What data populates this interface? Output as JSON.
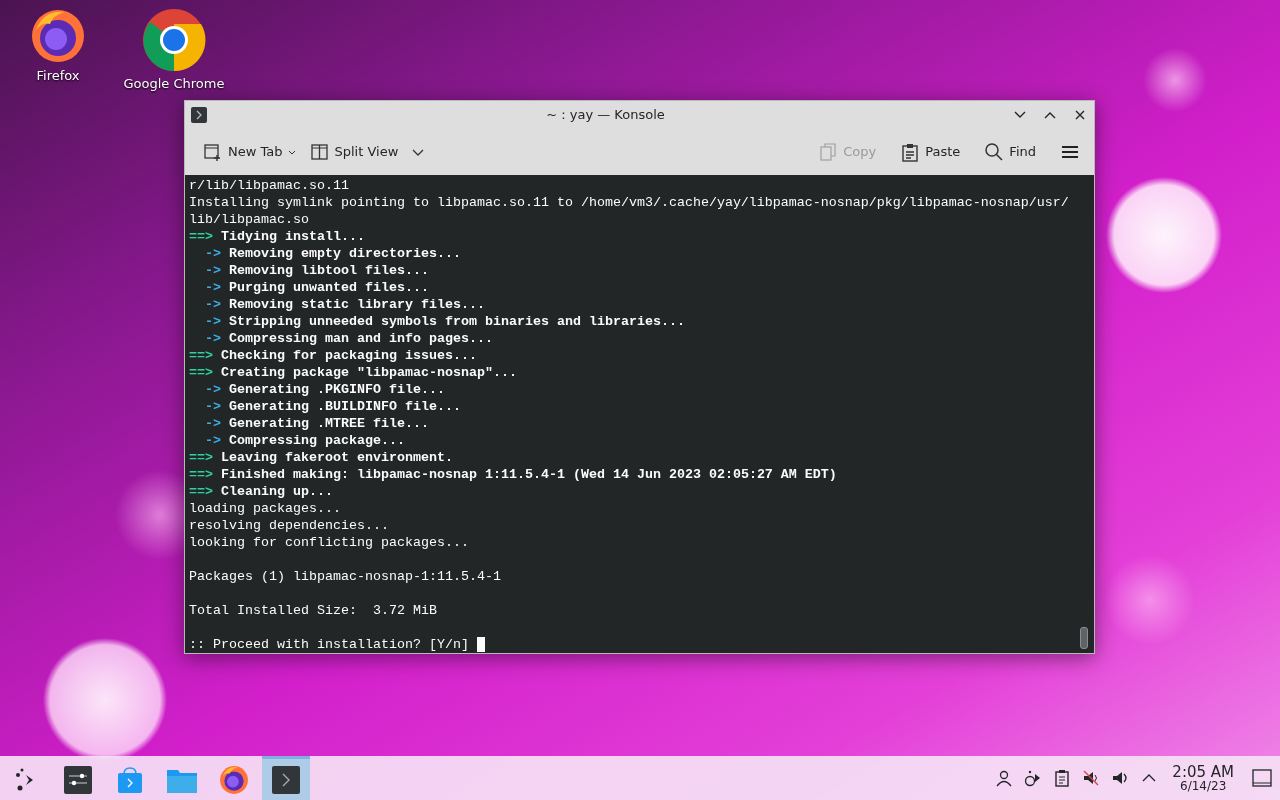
{
  "desktop_icons": [
    {
      "label": "Firefox",
      "kind": "firefox"
    },
    {
      "label": "Google Chrome",
      "kind": "chrome"
    }
  ],
  "window": {
    "title": "~ : yay — Konsole",
    "toolbar_left": [
      {
        "label": "New Tab",
        "kind": "new-tab",
        "disabled": false
      },
      {
        "label": "Split View",
        "kind": "split-view",
        "disabled": false
      }
    ],
    "toolbar_right": [
      {
        "label": "Copy",
        "kind": "copy",
        "disabled": true
      },
      {
        "label": "Paste",
        "kind": "paste",
        "disabled": false
      },
      {
        "label": "Find",
        "kind": "find",
        "disabled": false
      },
      {
        "kind": "menu",
        "disabled": false
      }
    ],
    "terminal": [
      {
        "kind": "plain",
        "text": "r/lib/libpamac.so.11"
      },
      {
        "kind": "plain",
        "text": "Installing symlink pointing to libpamac.so.11 to /home/vm3/.cache/yay/libpamac-nosnap/pkg/libpamac-nosnap/usr/"
      },
      {
        "kind": "plain",
        "text": "lib/libpamac.so"
      },
      {
        "kind": "header",
        "prefix": "==>",
        "text": "Tidying install..."
      },
      {
        "kind": "step",
        "prefix": "->",
        "text": "Removing empty directories..."
      },
      {
        "kind": "step",
        "prefix": "->",
        "text": "Removing libtool files..."
      },
      {
        "kind": "step",
        "prefix": "->",
        "text": "Purging unwanted files..."
      },
      {
        "kind": "step",
        "prefix": "->",
        "text": "Removing static library files..."
      },
      {
        "kind": "step",
        "prefix": "->",
        "text": "Stripping unneeded symbols from binaries and libraries..."
      },
      {
        "kind": "step",
        "prefix": "->",
        "text": "Compressing man and info pages..."
      },
      {
        "kind": "header",
        "prefix": "==>",
        "text": "Checking for packaging issues..."
      },
      {
        "kind": "header",
        "prefix": "==>",
        "text": "Creating package \"libpamac-nosnap\"..."
      },
      {
        "kind": "step",
        "prefix": "->",
        "text": "Generating .PKGINFO file..."
      },
      {
        "kind": "step",
        "prefix": "->",
        "text": "Generating .BUILDINFO file..."
      },
      {
        "kind": "step",
        "prefix": "->",
        "text": "Generating .MTREE file..."
      },
      {
        "kind": "step",
        "prefix": "->",
        "text": "Compressing package..."
      },
      {
        "kind": "header",
        "prefix": "==>",
        "text": "Leaving fakeroot environment."
      },
      {
        "kind": "header",
        "prefix": "==>",
        "text": "Finished making: libpamac-nosnap 1:11.5.4-1 (Wed 14 Jun 2023 02:05:27 AM EDT)"
      },
      {
        "kind": "header",
        "prefix": "==>",
        "text": "Cleaning up..."
      },
      {
        "kind": "plain",
        "text": "loading packages..."
      },
      {
        "kind": "plain",
        "text": "resolving dependencies..."
      },
      {
        "kind": "plain",
        "text": "looking for conflicting packages..."
      },
      {
        "kind": "blank"
      },
      {
        "kind": "plain",
        "text": "Packages (1) libpamac-nosnap-1:11.5.4-1"
      },
      {
        "kind": "blank"
      },
      {
        "kind": "plain",
        "text": "Total Installed Size:  3.72 MiB"
      },
      {
        "kind": "blank"
      },
      {
        "kind": "prompt",
        "text": ":: Proceed with installation? [Y/n]"
      }
    ]
  },
  "taskbar": {
    "apps": [
      {
        "kind": "launcher",
        "active": false
      },
      {
        "kind": "settings",
        "active": false
      },
      {
        "kind": "discover",
        "active": false
      },
      {
        "kind": "files",
        "active": false
      },
      {
        "kind": "firefox",
        "active": false
      },
      {
        "kind": "konsole",
        "active": true
      }
    ],
    "tray": [
      {
        "kind": "user"
      },
      {
        "kind": "network"
      },
      {
        "kind": "clipboard"
      },
      {
        "kind": "mic-muted"
      },
      {
        "kind": "volume"
      },
      {
        "kind": "expand"
      }
    ],
    "time": "2:05 AM",
    "date": "6/14/23"
  }
}
